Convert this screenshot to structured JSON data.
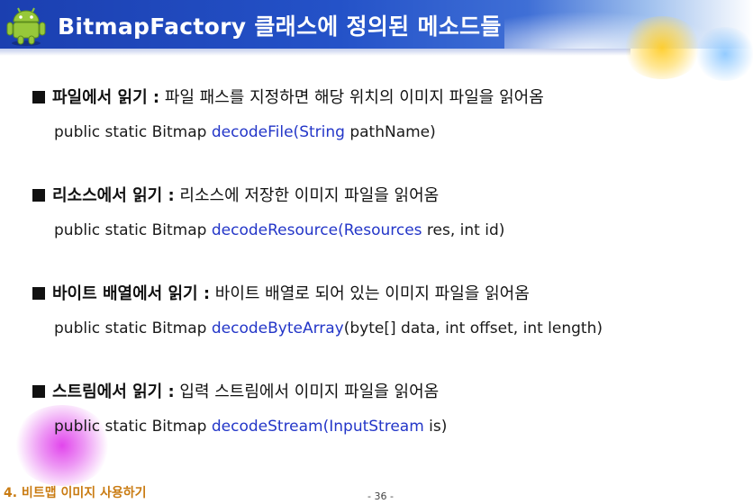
{
  "header": {
    "title": "BitmapFactory 클래스에 정의된 메소드들",
    "logo_icon": "android-robot-icon",
    "colors": {
      "band": "#1b3fb0",
      "title": "#ffffff"
    }
  },
  "sections": [
    {
      "title": "파일에서 읽기 :",
      "description": "파일 패스를 지정하면 해당 위치의 이미지 파일을 읽어옴",
      "signature": {
        "prefix": "public static Bitmap",
        "method": "decodeFile(",
        "param_type": "String",
        "rest": " pathName)"
      }
    },
    {
      "title": "리소스에서 읽기 :",
      "description": "리소스에 저장한 이미지 파일을 읽어옴",
      "signature": {
        "prefix": "public static Bitmap",
        "method": "decodeResource(",
        "param_type": "Resources",
        "rest": " res, int id)"
      }
    },
    {
      "title": "바이트 배열에서 읽기 :",
      "description": "바이트 배열로 되어 있는 이미지 파일을 읽어옴",
      "signature": {
        "prefix": "public static Bitmap",
        "method": "decodeByteArray",
        "param_type": "",
        "rest": "(byte[] data, int offset, int length)"
      }
    },
    {
      "title": "스트림에서 읽기 :",
      "description": "입력 스트림에서 이미지 파일을 읽어옴",
      "signature": {
        "prefix": "public static Bitmap",
        "method": "decodeStream(",
        "param_type": "InputStream",
        "rest": " is)"
      }
    }
  ],
  "footer": {
    "chapter": "4. 비트맵 이미지 사용하기",
    "page": "- 36 -"
  },
  "colors": {
    "method": "#2336c8",
    "chapter": "#c97b12"
  }
}
